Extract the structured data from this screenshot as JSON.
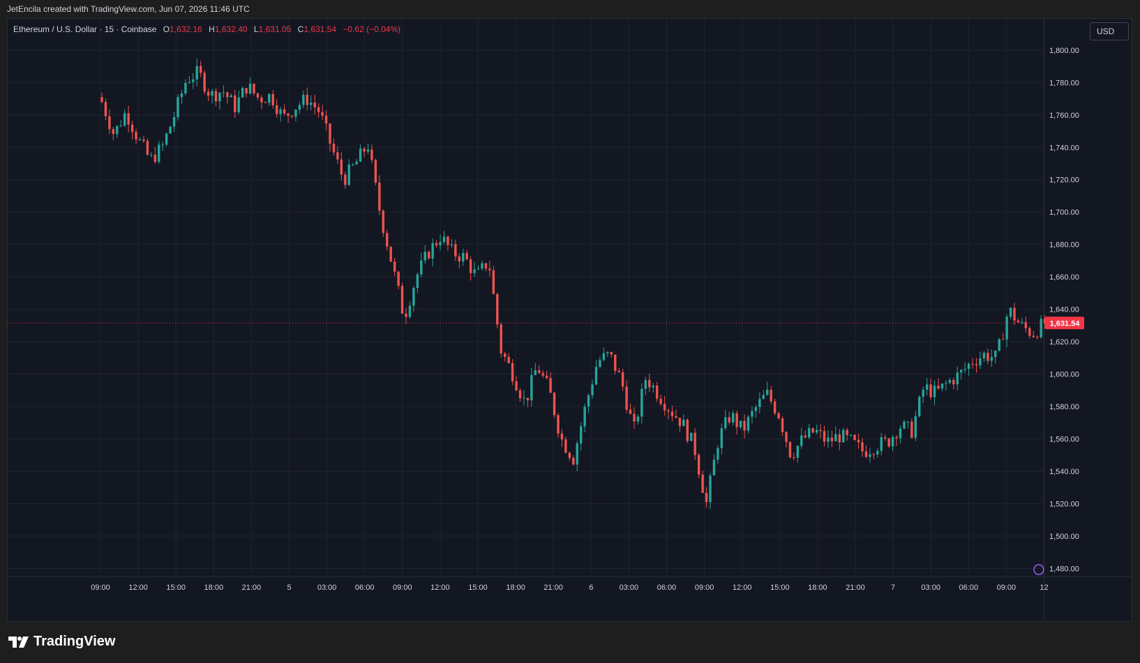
{
  "header": {
    "credit": "JetEncila created with TradingView.com, Jun 07, 2026 11:46 UTC"
  },
  "legend": {
    "symbol": "Ethereum / U.S. Dollar · 15 · Coinbase",
    "o_label": "O",
    "o_value": "1,632.16",
    "h_label": "H",
    "h_value": "1,632.40",
    "l_label": "L",
    "l_value": "1,631.05",
    "c_label": "C",
    "c_value": "1,631.54",
    "change": "−0.62 (−0.04%)"
  },
  "currency_label": "USD",
  "footer": {
    "brand": "TradingView"
  },
  "colors": {
    "background": "#131722",
    "grid": "#1f2430",
    "text": "#d1d4dc",
    "up": "#26a69a",
    "down": "#ef5350",
    "price_line": "#f23645"
  },
  "chart_data": {
    "type": "candlestick",
    "title": "Ethereum / U.S. Dollar · 15 · Coinbase",
    "ylim": [
      1475,
      1815
    ],
    "y_ticks": [
      1480,
      1500,
      1520,
      1540,
      1560,
      1580,
      1600,
      1620,
      1640,
      1660,
      1680,
      1700,
      1720,
      1740,
      1760,
      1780,
      1800
    ],
    "x_ticks": [
      "09:00",
      "12:00",
      "15:00",
      "18:00",
      "21:00",
      "5",
      "03:00",
      "06:00",
      "09:00",
      "12:00",
      "15:00",
      "18:00",
      "21:00",
      "6",
      "03:00",
      "06:00",
      "09:00",
      "12:00",
      "15:00",
      "18:00",
      "21:00",
      "7",
      "03:00",
      "06:00",
      "09:00",
      "12"
    ],
    "last_price": 1631.54,
    "last_price_label": "1,631.54",
    "grid": true,
    "keyframes": [
      {
        "close": 1768
      },
      {
        "close": 1748
      },
      {
        "close": 1762
      },
      {
        "close": 1745
      },
      {
        "close": 1732
      },
      {
        "close": 1740
      },
      {
        "close": 1760
      },
      {
        "close": 1782
      },
      {
        "close": 1786
      },
      {
        "close": 1772
      },
      {
        "close": 1775
      },
      {
        "close": 1765
      },
      {
        "close": 1778
      },
      {
        "close": 1770
      },
      {
        "close": 1772
      },
      {
        "close": 1758
      },
      {
        "close": 1765
      },
      {
        "close": 1770
      },
      {
        "close": 1762
      },
      {
        "close": 1740
      },
      {
        "close": 1720
      },
      {
        "close": 1730
      },
      {
        "close": 1742
      },
      {
        "close": 1700
      },
      {
        "close": 1668
      },
      {
        "close": 1635
      },
      {
        "close": 1660
      },
      {
        "close": 1675
      },
      {
        "close": 1685
      },
      {
        "close": 1675
      },
      {
        "close": 1672
      },
      {
        "close": 1660
      },
      {
        "close": 1670
      },
      {
        "close": 1615
      },
      {
        "close": 1600
      },
      {
        "close": 1582
      },
      {
        "close": 1605
      },
      {
        "close": 1590
      },
      {
        "close": 1560
      },
      {
        "close": 1548
      },
      {
        "close": 1580
      },
      {
        "close": 1608
      },
      {
        "close": 1612
      },
      {
        "close": 1595
      },
      {
        "close": 1565
      },
      {
        "close": 1598
      },
      {
        "close": 1588
      },
      {
        "close": 1578
      },
      {
        "close": 1570
      },
      {
        "close": 1555
      },
      {
        "close": 1520
      },
      {
        "close": 1560
      },
      {
        "close": 1575
      },
      {
        "close": 1565
      },
      {
        "close": 1578
      },
      {
        "close": 1588
      },
      {
        "close": 1575
      },
      {
        "close": 1550
      },
      {
        "close": 1560
      },
      {
        "close": 1565
      },
      {
        "close": 1558
      },
      {
        "close": 1562
      },
      {
        "close": 1558
      },
      {
        "close": 1552
      },
      {
        "close": 1556
      },
      {
        "close": 1558
      },
      {
        "close": 1568
      },
      {
        "close": 1565
      },
      {
        "close": 1592
      },
      {
        "close": 1588
      },
      {
        "close": 1595
      },
      {
        "close": 1600
      },
      {
        "close": 1608
      },
      {
        "close": 1612
      },
      {
        "close": 1610
      },
      {
        "close": 1640
      },
      {
        "close": 1630
      },
      {
        "close": 1625
      },
      {
        "close": 1631.54
      }
    ]
  }
}
